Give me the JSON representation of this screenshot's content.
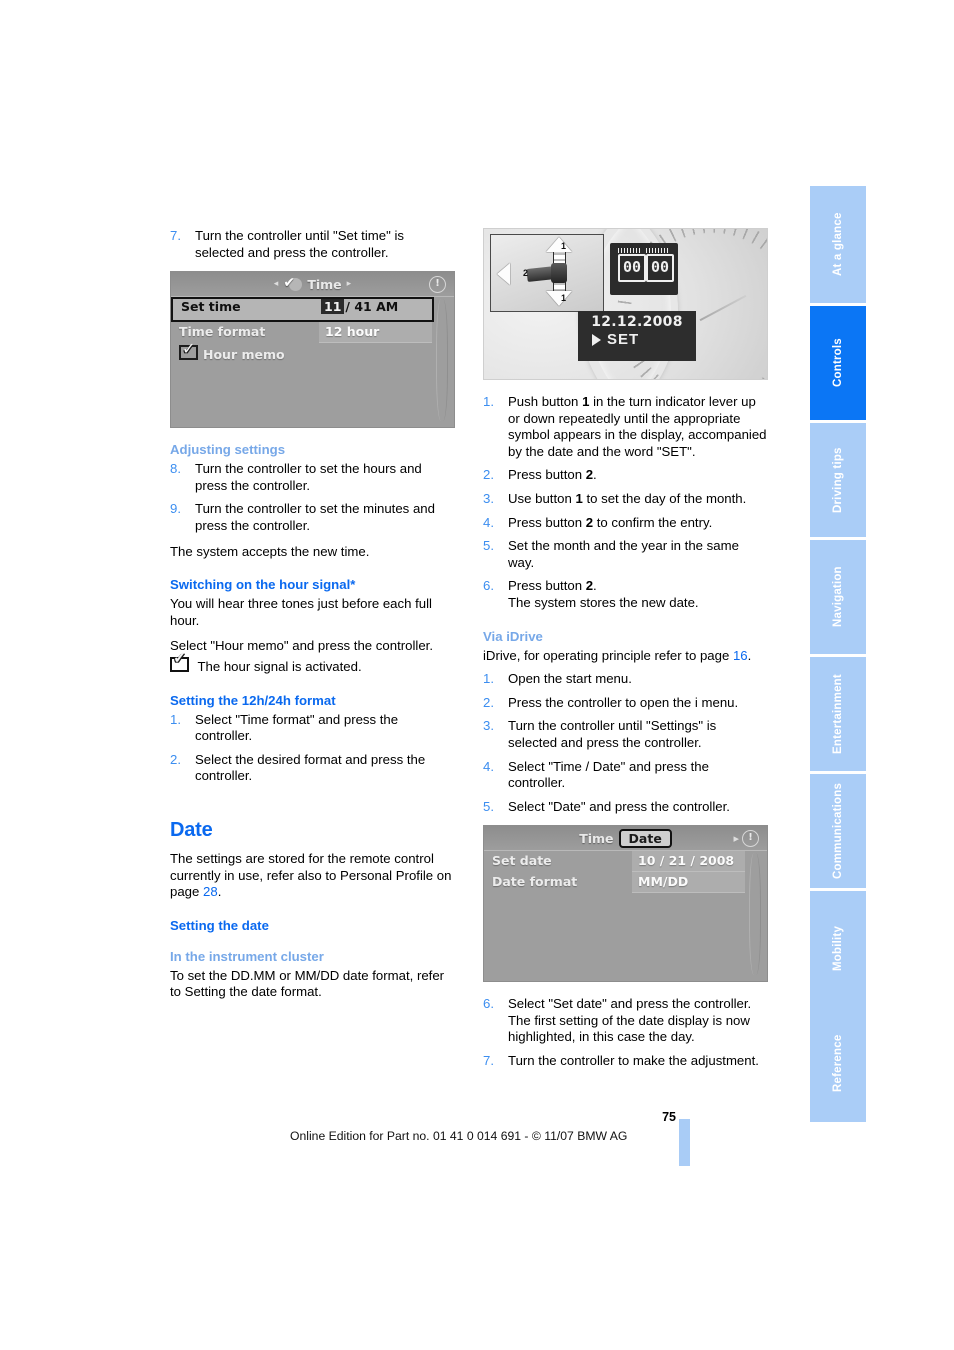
{
  "page": {
    "number": "75",
    "footer": "Online Edition for Part no. 01 41 0 014 691 - © 11/07 BMW AG"
  },
  "sidebar": {
    "tabs": [
      {
        "label": "At a glance",
        "active": false
      },
      {
        "label": "Controls",
        "active": true
      },
      {
        "label": "Driving tips",
        "active": false
      },
      {
        "label": "Navigation",
        "active": false
      },
      {
        "label": "Entertainment",
        "active": false
      },
      {
        "label": "Communications",
        "active": false
      },
      {
        "label": "Mobility",
        "active": false
      },
      {
        "label": "Reference",
        "active": false
      }
    ]
  },
  "left_column": {
    "step7": {
      "num": "7.",
      "text": "Turn the controller until \"Set time\" is selected and press the controller."
    },
    "time_screen": {
      "title": "Time",
      "left_arrow": "◂",
      "right_arrow": "▸",
      "info_icon": "!",
      "rows": [
        {
          "label": "Set time",
          "value_highlight": "11",
          "value_rest": "/ 41 AM"
        },
        {
          "label": "Time format",
          "value": "12 hour"
        },
        {
          "label": "Hour memo",
          "value": ""
        }
      ]
    },
    "adjusting": {
      "heading": "Adjusting settings",
      "steps": [
        {
          "num": "8.",
          "text": "Turn the controller to set the hours and press the controller."
        },
        {
          "num": "9.",
          "text": "Turn the controller to set the minutes and press the controller."
        }
      ],
      "note": "The system accepts the new time."
    },
    "hour_signal": {
      "heading": "Switching on the hour signal*",
      "para1": "You will hear three tones just before each full hour.",
      "para2": "Select \"Hour memo\" and press the controller.",
      "para3": "The hour signal is activated."
    },
    "format_1224": {
      "heading": "Setting the 12h/24h format",
      "steps": [
        {
          "num": "1.",
          "text": "Select \"Time format\" and press the controller."
        },
        {
          "num": "2.",
          "text": "Select the desired format and press the controller."
        }
      ]
    },
    "date_section": {
      "heading": "Date",
      "intro_a": "The settings are stored for the remote control currently in use, refer also to Personal Profile on page ",
      "intro_link": "28",
      "intro_b": ".",
      "setting_the_date": "Setting the date",
      "instrument_cluster_heading": "In the instrument cluster",
      "instrument_cluster_text": "To set the DD.MM or MM/DD date format, refer to Setting the date format."
    }
  },
  "right_column": {
    "cluster_figure": {
      "button_1_label": "1",
      "button_2_label": "2",
      "lcd_left": "00",
      "lcd_right": "00",
      "date_text": "12.12.2008",
      "set_text": "SET"
    },
    "cluster_steps": [
      {
        "num": "1.",
        "parts": [
          "Push button ",
          "1",
          " in the turn indicator lever up or down repeatedly until the appropriate symbol appears in the display, accompanied by the date and the word \"SET\"."
        ]
      },
      {
        "num": "2.",
        "parts": [
          "Press button ",
          "2",
          "."
        ]
      },
      {
        "num": "3.",
        "parts": [
          "Use button ",
          "1",
          " to set the day of the month."
        ]
      },
      {
        "num": "4.",
        "parts": [
          "Press button ",
          "2",
          " to confirm the entry."
        ]
      },
      {
        "num": "5.",
        "parts": [
          "Set the month and the year in the same way.",
          "",
          ""
        ]
      },
      {
        "num": "6.",
        "parts": [
          "Press button ",
          "2",
          ".\nThe system stores the new date."
        ]
      }
    ],
    "via_idrive": {
      "heading": "Via iDrive",
      "intro_a": "iDrive, for operating principle refer to page ",
      "intro_link": "16",
      "intro_b": ".",
      "steps": [
        {
          "num": "1.",
          "text": "Open the start menu."
        },
        {
          "num": "2.",
          "text": "Press the controller to open the i menu."
        },
        {
          "num": "3.",
          "text": "Turn the controller until \"Settings\" is selected and press the controller."
        },
        {
          "num": "4.",
          "text": "Select \"Time / Date\" and press the controller."
        },
        {
          "num": "5.",
          "text": "Select \"Date\" and press the controller."
        }
      ]
    },
    "date_screen": {
      "tab_inactive": "Time",
      "tab_active": "Date",
      "right_arrow": "▸",
      "info_icon": "!",
      "rows": [
        {
          "label": "Set date",
          "value": "10 / 21 / 2008"
        },
        {
          "label": "Date format",
          "value": "MM/DD"
        }
      ]
    },
    "steps_after": [
      {
        "num": "6.",
        "text": "Select \"Set date\" and press the controller. The first setting of the date display is now highlighted, in this case the day."
      },
      {
        "num": "7.",
        "text": "Turn the controller to make the adjustment."
      }
    ]
  }
}
